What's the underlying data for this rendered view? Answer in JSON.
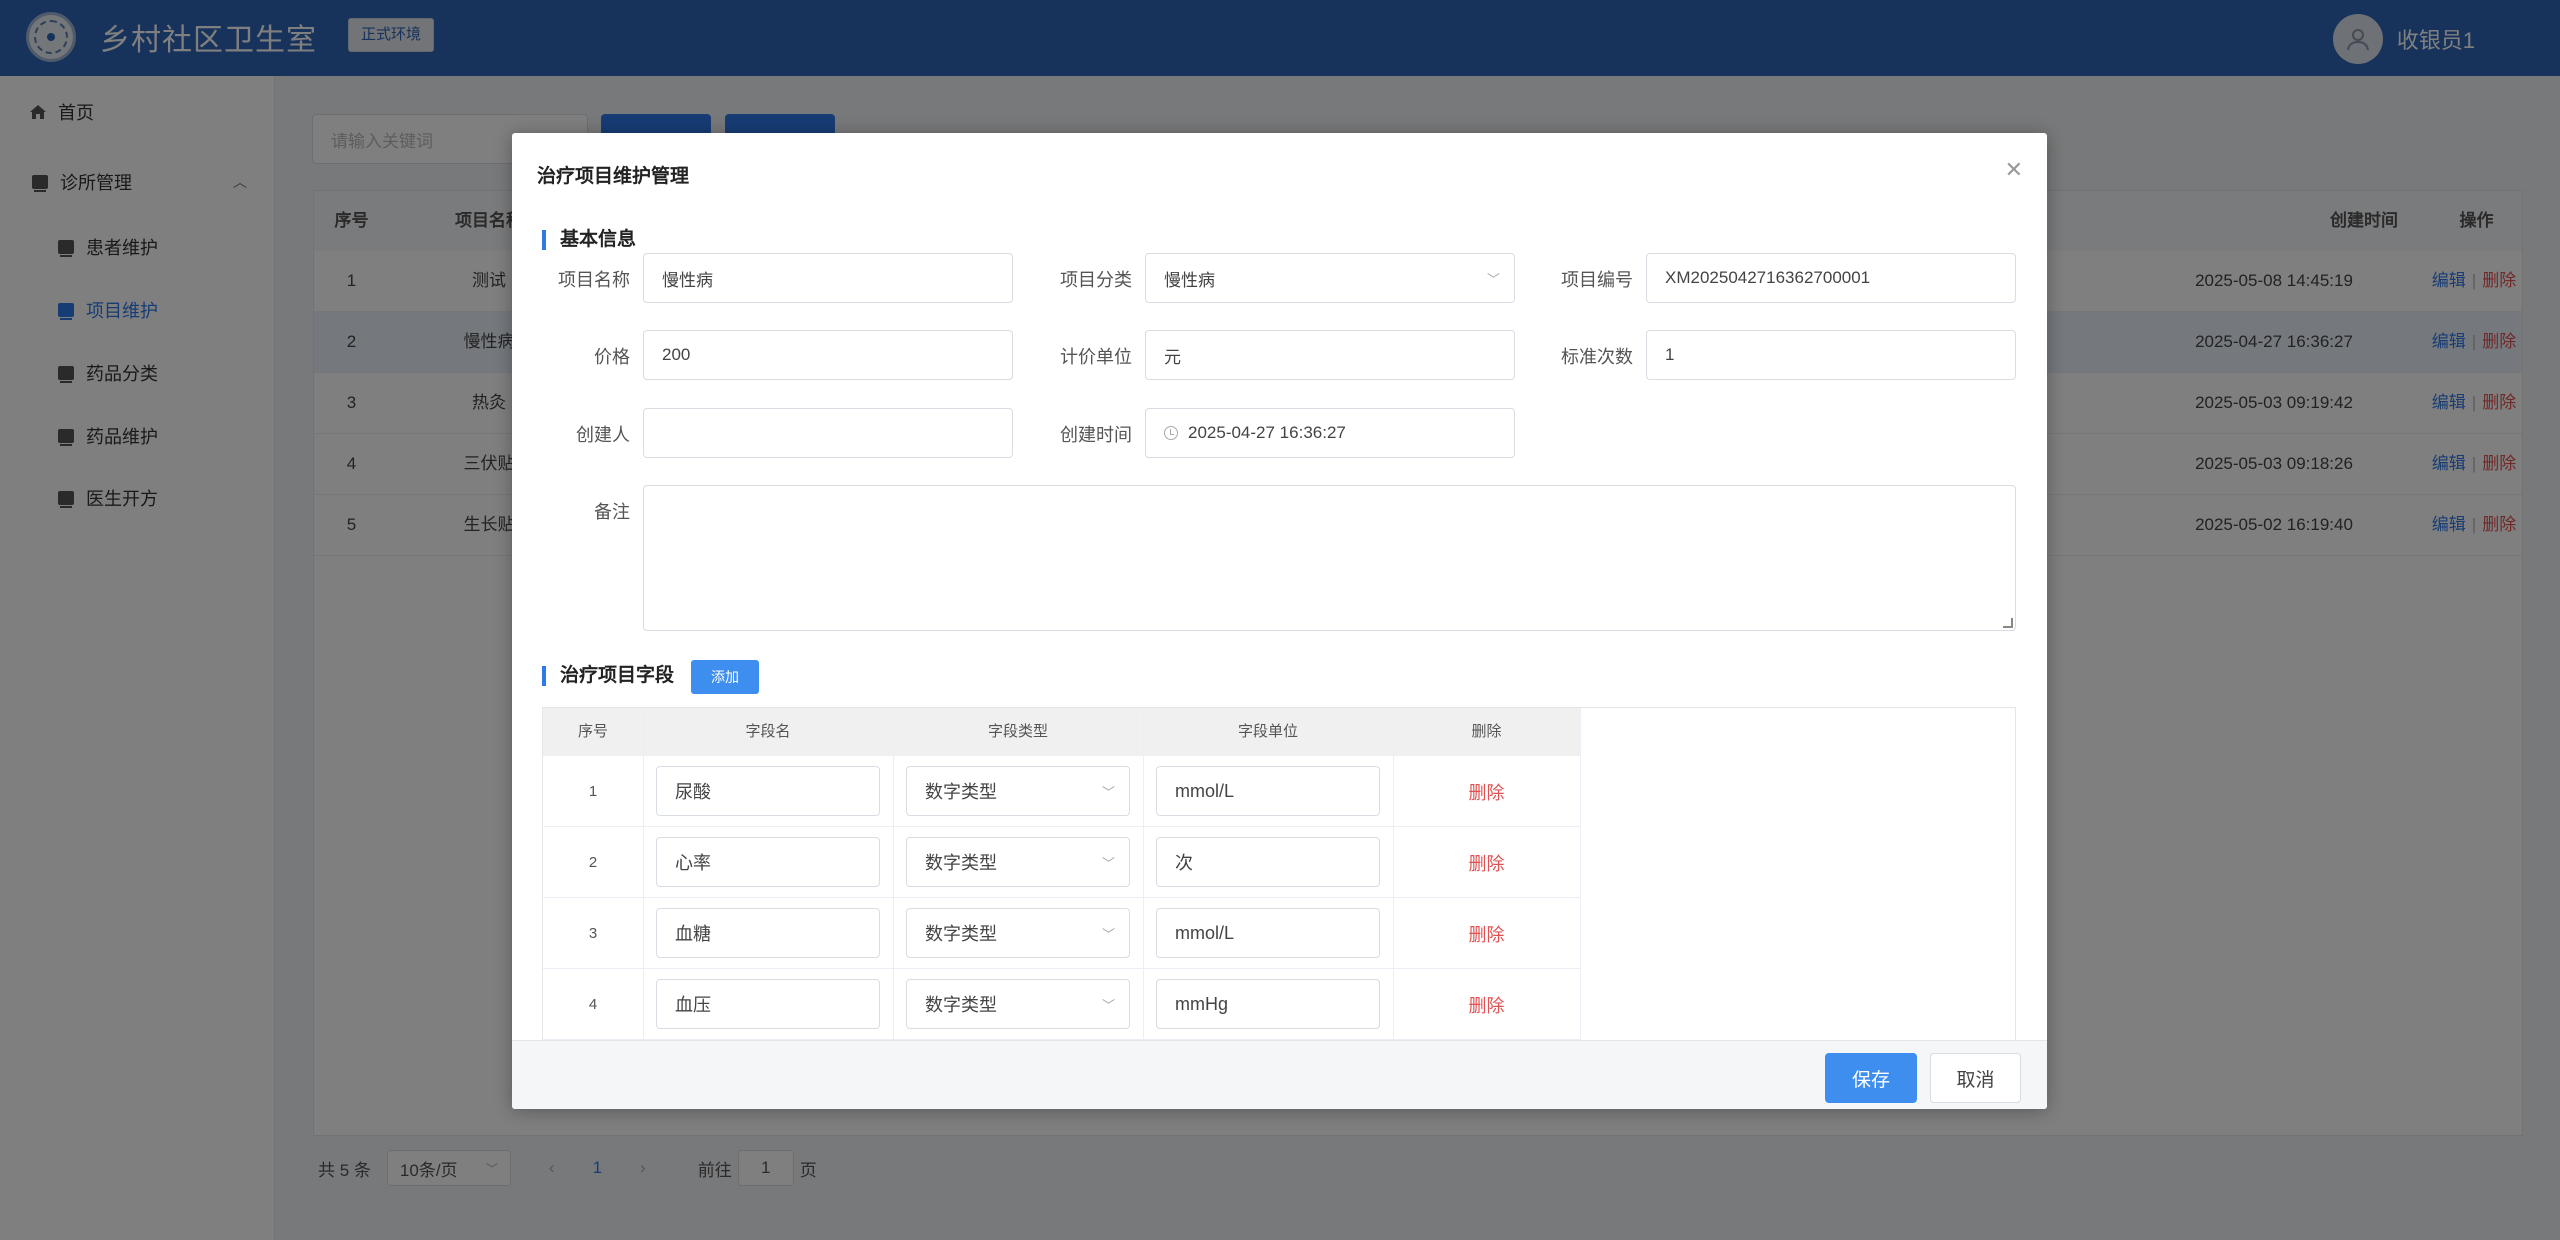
{
  "header": {
    "app_title": "乡村社区卫生室",
    "env_badge": "正式环境",
    "user_name": "收银员1"
  },
  "sidebar": {
    "items": [
      {
        "label": "首页",
        "icon": "home-icon"
      },
      {
        "label": "诊所管理",
        "icon": "folder-icon"
      },
      {
        "label": "患者维护",
        "icon": "doc-icon"
      },
      {
        "label": "项目维护",
        "icon": "doc-icon",
        "active": true
      },
      {
        "label": "药品分类",
        "icon": "doc-icon"
      },
      {
        "label": "药品维护",
        "icon": "doc-icon"
      },
      {
        "label": "医生开方",
        "icon": "doc-icon"
      }
    ]
  },
  "main": {
    "search_placeholder": "请输入关键词",
    "table": {
      "headers": {
        "index": "序号",
        "name": "项目名称",
        "created": "创建时间",
        "ops": "操作"
      },
      "rows": [
        {
          "index": "1",
          "name": "测试",
          "created": "2025-05-08 14:45:19"
        },
        {
          "index": "2",
          "name": "慢性病",
          "created": "2025-04-27 16:36:27"
        },
        {
          "index": "3",
          "name": "热灸",
          "created": "2025-05-03 09:19:42"
        },
        {
          "index": "4",
          "name": "三伏贴",
          "created": "2025-05-03 09:18:26"
        },
        {
          "index": "5",
          "name": "生长贴",
          "created": "2025-05-02 16:19:40"
        }
      ],
      "edit_label": "编辑",
      "delete_label": "删除"
    },
    "pager": {
      "total": "共 5 条",
      "page_size": "10条/页",
      "current_page": "1",
      "goto_label": "前往",
      "goto_value": "1",
      "page_suffix": "页"
    }
  },
  "dialog": {
    "title": "治疗项目维护管理",
    "basic_section": "基本信息",
    "fields": {
      "name_label": "项目名称",
      "name_value": "慢性病",
      "category_label": "项目分类",
      "category_value": "慢性病",
      "code_label": "项目编号",
      "code_value": "XM2025042716362700001",
      "price_label": "价格",
      "price_value": "200",
      "unit_label": "计价单位",
      "unit_value": "元",
      "count_label": "标准次数",
      "count_value": "1",
      "creator_label": "创建人",
      "creator_value": "",
      "created_label": "创建时间",
      "created_value": "2025-04-27 16:36:27",
      "remark_label": "备注"
    },
    "field_section": "治疗项目字段",
    "add_label": "添加",
    "field_table": {
      "headers": {
        "index": "序号",
        "name": "字段名",
        "type": "字段类型",
        "unit": "字段单位",
        "delete": "删除"
      },
      "rows": [
        {
          "index": "1",
          "name": "尿酸",
          "type": "数字类型",
          "unit": "mmol/L"
        },
        {
          "index": "2",
          "name": "心率",
          "type": "数字类型",
          "unit": "次"
        },
        {
          "index": "3",
          "name": "血糖",
          "type": "数字类型",
          "unit": "mmol/L"
        },
        {
          "index": "4",
          "name": "血压",
          "type": "数字类型",
          "unit": "mmHg"
        }
      ],
      "delete_label": "删除"
    },
    "save_label": "保存",
    "cancel_label": "取消"
  },
  "colors": {
    "header_bg": "#2f65b7",
    "primary": "#3e8eef",
    "danger": "#e05252"
  }
}
